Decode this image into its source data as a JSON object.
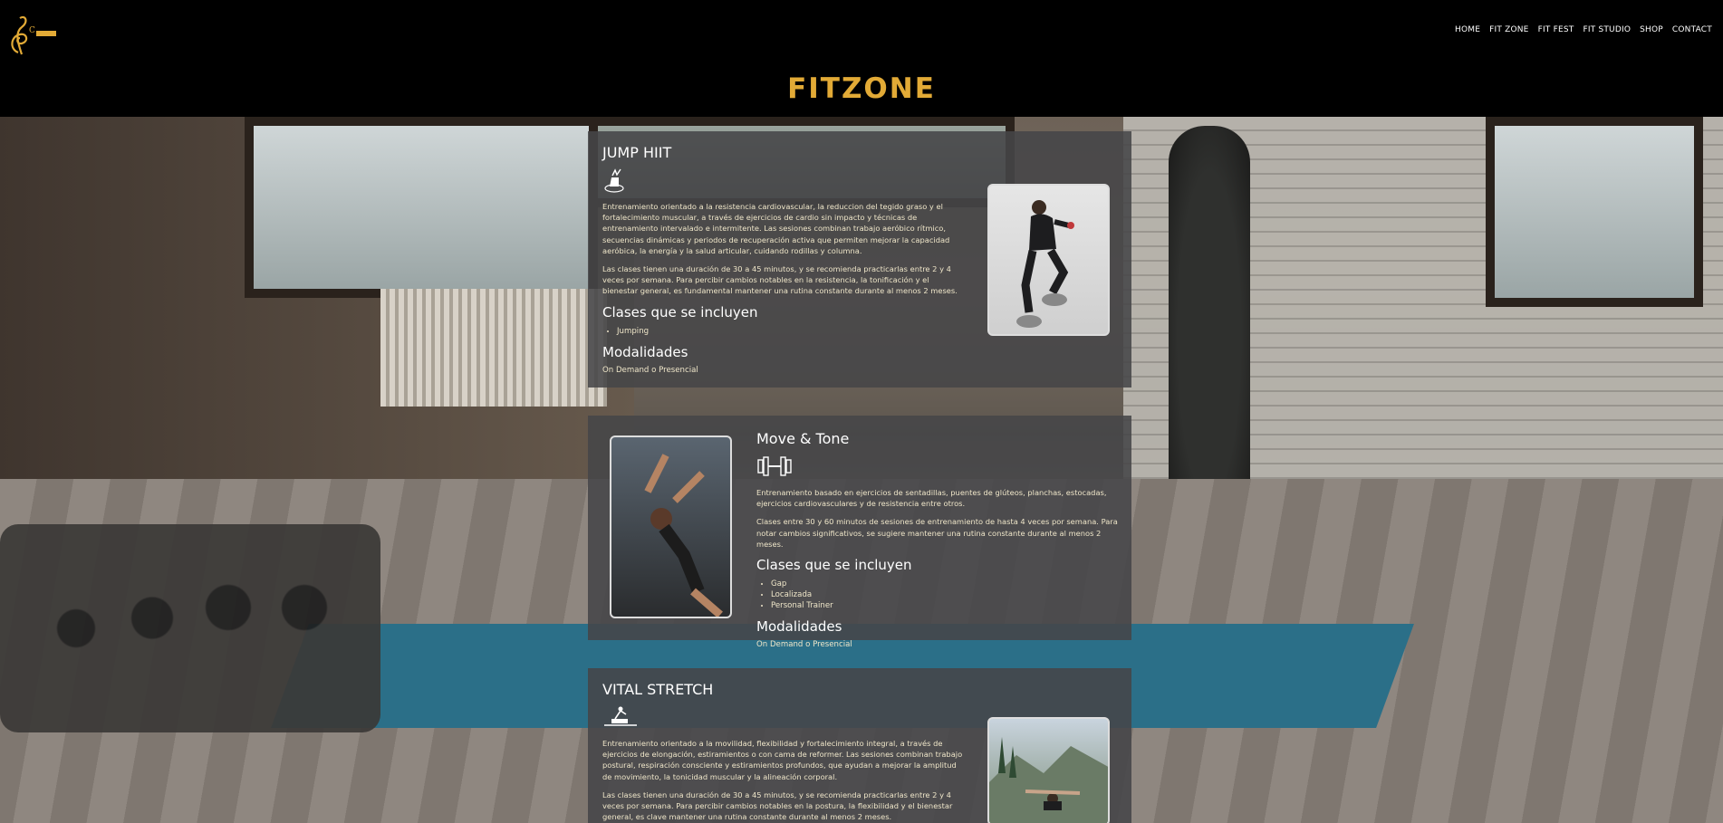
{
  "nav": {
    "items": [
      "HOME",
      "FIT ZONE",
      "FIT FEST",
      "FIT STUDIO",
      "SHOP",
      "CONTACT"
    ]
  },
  "page": {
    "title": "FITZONE"
  },
  "cards": [
    {
      "title": "JUMP HIIT",
      "icon": "kangoo-jump-icon",
      "paragraphs": [
        "Entrenamiento orientado a la resistencia cardiovascular, la reduccion del tegido graso y el fortalecimiento muscular, a través de ejercicios de cardio sin impacto y técnicas de entrenamiento intervalado e intermitente. Las sesiones combinan trabajo aeróbico rítmico, secuencias dinámicas y periodos de recuperación activa que permiten mejorar la capacidad aeróbica, la energía y la salud articular, cuidando rodillas y columna.",
        "Las clases tienen una duración de 30 a 45 minutos, y se recomienda practicarlas entre 2 y 4 veces por semana. Para percibir cambios notables en la resistencia, la tonificación y el bienestar general, es fundamental mantener una rutina constante durante al menos 2 meses."
      ],
      "classes_heading": "Clases que se incluyen",
      "classes": [
        "Jumping"
      ],
      "modalities_heading": "Modalidades",
      "modalities": "On Demand o Presencial"
    },
    {
      "title": "Move & Tone",
      "icon": "dumbbell-icon",
      "paragraphs": [
        "Entrenamiento basado en ejercicios de sentadillas, puentes de glúteos, planchas, estocadas, ejercicios cardiovasculares y de resistencia entre otros.",
        "Clases entre 30 y 60 minutos de sesiones de entrenamiento de hasta 4 veces por semana. Para notar cambios significativos, se sugiere mantener una rutina constante durante al menos 2 meses."
      ],
      "classes_heading": "Clases que se incluyen",
      "classes": [
        "Gap",
        "Localizada",
        "Personal Trainer"
      ],
      "modalities_heading": "Modalidades",
      "modalities": "On Demand o Presencial"
    },
    {
      "title": "VITAL STRETCH",
      "icon": "reformer-icon",
      "paragraphs": [
        "Entrenamiento orientado a la movilidad, flexibilidad y fortalecimiento integral, a través de ejercicios de elongación, estiramientos o con cama de reformer. Las sesiones combinan trabajo postural, respiración consciente y estiramientos profundos, que ayudan a mejorar la amplitud de movimiento, la tonicidad muscular y la alineación corporal.",
        "Las clases tienen una duración de 30 a 45 minutos, y se recomienda practicarlas entre 2 y 4 veces por semana. Para percibir cambios notables en la postura, la flexibilidad y el bienestar general, es clave mantener una rutina constante durante al menos 2 meses."
      ]
    }
  ],
  "colors": {
    "title_gold": "#e2aa36",
    "card_bg": "#464648",
    "text_cream": "#efe6c9"
  }
}
